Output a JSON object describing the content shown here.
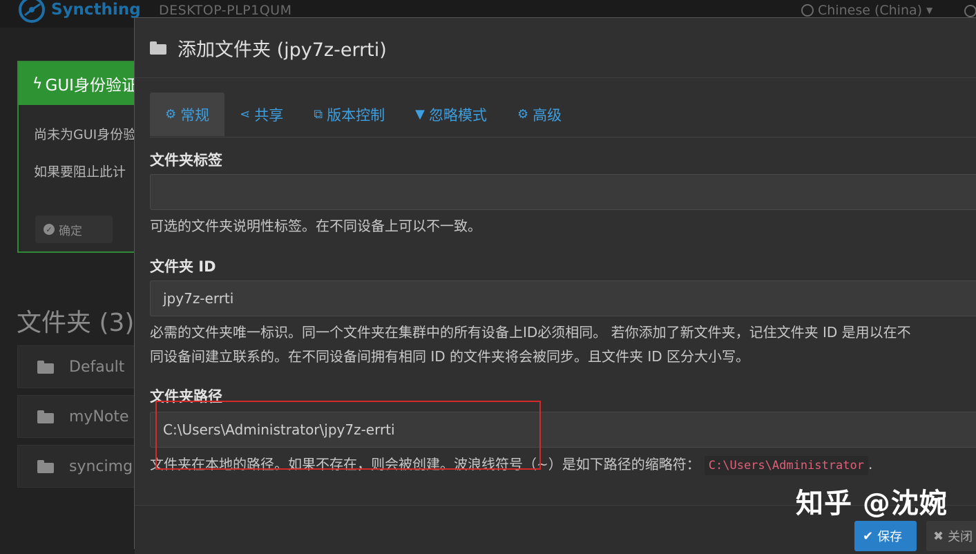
{
  "app": {
    "brand": "Syncthing",
    "device_name": "DESKTOP-PLP1QUM",
    "language": "Chinese (China)"
  },
  "auth_panel": {
    "title": "GUI身份验证",
    "line1": "尚未为GUI身份验证",
    "line2": "如果要阻止此计",
    "ok_label": "确定"
  },
  "folders": {
    "title": "文件夹 (3)",
    "items": [
      {
        "label": "Default"
      },
      {
        "label": "myNote"
      },
      {
        "label": "syncimg"
      }
    ]
  },
  "modal": {
    "title": "添加文件夹 (jpy7z-errti)",
    "tabs": [
      {
        "label": "常规",
        "icon": "gear-icon"
      },
      {
        "label": "共享",
        "icon": "share-icon"
      },
      {
        "label": "版本控制",
        "icon": "copy-icon"
      },
      {
        "label": "忽略模式",
        "icon": "filter-icon"
      },
      {
        "label": "高级",
        "icon": "gears-icon"
      }
    ],
    "fields": {
      "label": {
        "title": "文件夹标签",
        "value": "",
        "help": "可选的文件夹说明性标签。在不同设备上可以不一致。"
      },
      "id": {
        "title": "文件夹 ID",
        "value": "jpy7z-errti",
        "help1": "必需的文件夹唯一标识。同一个文件夹在集群中的所有设备上ID必须相同。 若你添加了新文件夹，记住文件夹 ID 是用以在不",
        "help2": "同设备间建立联系的。在不同设备间拥有相同 ID 的文件夹将会被同步。且文件夹 ID 区分大小写。"
      },
      "path": {
        "title": "文件夹路径",
        "value": "C:\\Users\\Administrator\\jpy7z-errti",
        "help": "文件夹在本地的路径。如果不存在，则会被创建。波浪线符号（~）是如下路径的缩略符：",
        "help_code": "C:\\Users\\Administrator",
        "help_end": "."
      }
    },
    "footer": {
      "save_label": "保存",
      "close_label": "关闭"
    }
  },
  "watermark": "知乎 @沈婉",
  "colors": {
    "accent": "#3d9ee0",
    "highlight": "#d42a2a",
    "success": "#2e9433"
  }
}
